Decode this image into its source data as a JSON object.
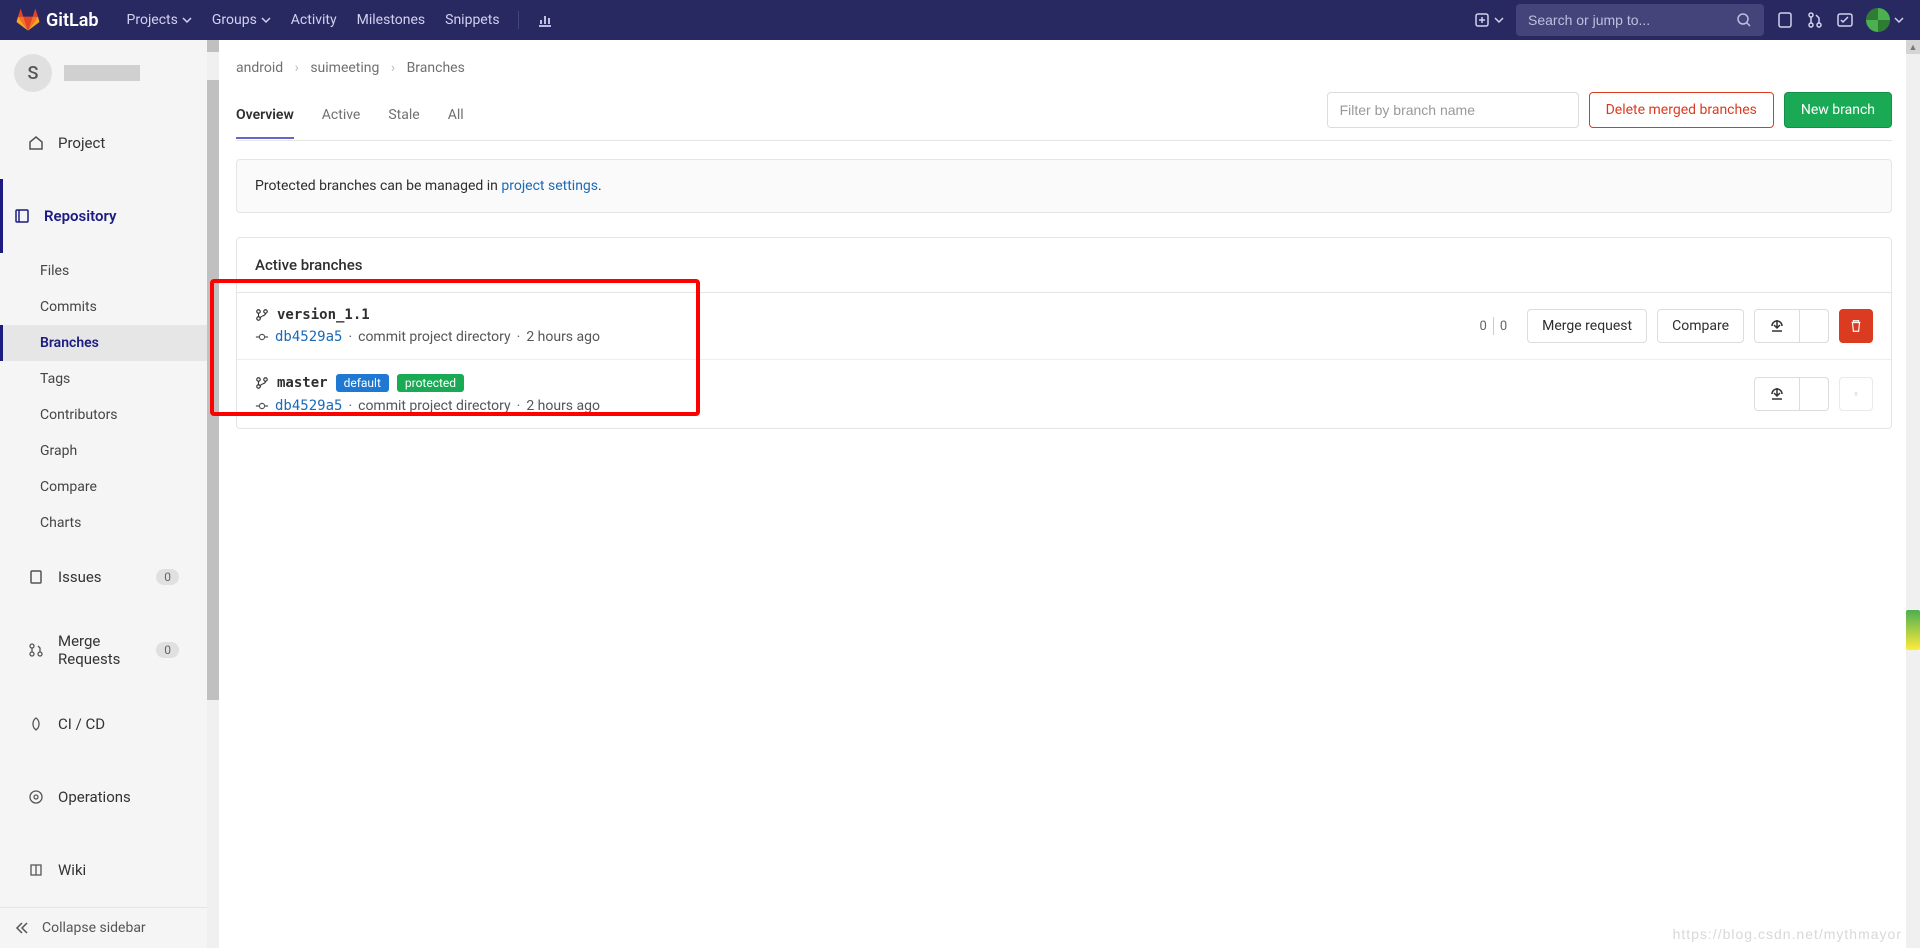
{
  "topnav": {
    "brand": "GitLab",
    "items": [
      "Projects",
      "Groups",
      "Activity",
      "Milestones",
      "Snippets"
    ],
    "search_placeholder": "Search or jump to..."
  },
  "project": {
    "initial": "S"
  },
  "sidebar": {
    "project": "Project",
    "repository": "Repository",
    "sub": {
      "files": "Files",
      "commits": "Commits",
      "branches": "Branches",
      "tags": "Tags",
      "contributors": "Contributors",
      "graph": "Graph",
      "compare": "Compare",
      "charts": "Charts"
    },
    "issues": "Issues",
    "issues_count": "0",
    "merge_requests": "Merge Requests",
    "mr_count": "0",
    "cicd": "CI / CD",
    "operations": "Operations",
    "wiki": "Wiki",
    "collapse": "Collapse sidebar"
  },
  "breadcrumb": {
    "a": "android",
    "b": "suimeeting",
    "c": "Branches"
  },
  "tabs": {
    "overview": "Overview",
    "active": "Active",
    "stale": "Stale",
    "all": "All"
  },
  "toolbar": {
    "filter_placeholder": "Filter by branch name",
    "delete_merged": "Delete merged branches",
    "new_branch": "New branch"
  },
  "banner": {
    "text_a": "Protected branches can be managed in ",
    "link": "project settings",
    "text_b": "."
  },
  "panel": {
    "title": "Active branches"
  },
  "branches": [
    {
      "name": "version_1.1",
      "sha": "db4529a5",
      "msg": "commit project directory",
      "time": "2 hours ago",
      "default": false,
      "protected": false,
      "behind": "0",
      "ahead": "0",
      "merge_request": "Merge request",
      "compare": "Compare",
      "deletable": true
    },
    {
      "name": "master",
      "sha": "db4529a5",
      "msg": "commit project directory",
      "time": "2 hours ago",
      "default": true,
      "protected": true,
      "deletable": false
    }
  ],
  "badges": {
    "default": "default",
    "protected": "protected"
  },
  "watermark": "https://blog.csdn.net/mythmayor"
}
